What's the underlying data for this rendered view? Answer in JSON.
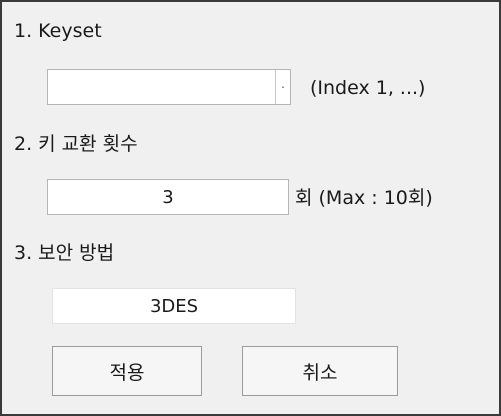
{
  "section1": {
    "label": "1.  Keyset",
    "select_value": "",
    "hint": "(Index 1, ...)",
    "dropdown_glyph": "·"
  },
  "section2": {
    "label": "2.  키 교환 횟수",
    "value": "3",
    "suffix": "회 (Max : 10회)"
  },
  "section3": {
    "label": "3.  보안 방법",
    "value": "3DES"
  },
  "buttons": {
    "apply": "적용",
    "cancel": "취소"
  }
}
